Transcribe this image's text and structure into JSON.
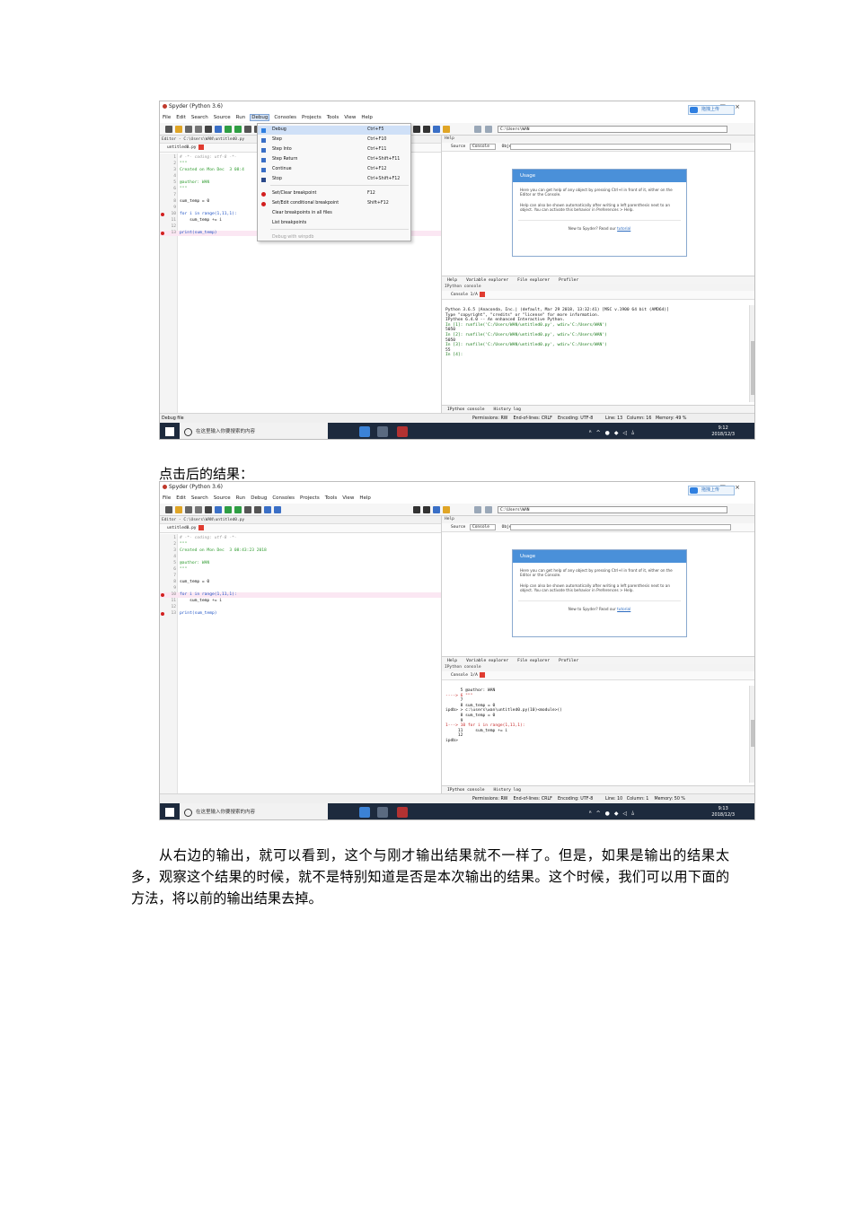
{
  "screenshot1": {
    "window_title": "Spyder (Python 3.6)",
    "menus": [
      "File",
      "Edit",
      "Search",
      "Source",
      "Run",
      "Debug",
      "Consoles",
      "Projects",
      "Tools",
      "View",
      "Help"
    ],
    "cloud_button": "拖拽上传",
    "path": "C:\\Users\\WAN",
    "editor_title": "Editor - C:\\Users\\WAN\\untitled0.py",
    "editor_tab": "untitled0.py",
    "code": [
      {
        "n": "1",
        "t": "# -*- coding: utf-8 -*-"
      },
      {
        "n": "2",
        "t": "\"\"\""
      },
      {
        "n": "3",
        "t": "Created on Mon Dec  3 08:4"
      },
      {
        "n": "4",
        "t": ""
      },
      {
        "n": "5",
        "t": "@author: WAN"
      },
      {
        "n": "6",
        "t": "\"\"\""
      },
      {
        "n": "7",
        "t": ""
      },
      {
        "n": "8",
        "t": "sum_temp = 0"
      },
      {
        "n": "9",
        "t": ""
      },
      {
        "n": "10",
        "t": "for i in range(1,11,1):"
      },
      {
        "n": "11",
        "t": "    sum_temp += i"
      },
      {
        "n": "12",
        "t": ""
      },
      {
        "n": "13",
        "t": "print(sum_temp)"
      }
    ],
    "debug_menu": [
      {
        "label": "Debug",
        "shortcut": "Ctrl+F5"
      },
      {
        "label": "Step",
        "shortcut": "Ctrl+F10"
      },
      {
        "label": "Step Into",
        "shortcut": "Ctrl+F11"
      },
      {
        "label": "Step Return",
        "shortcut": "Ctrl+Shift+F11"
      },
      {
        "label": "Continue",
        "shortcut": "Ctrl+F12"
      },
      {
        "label": "Stop",
        "shortcut": "Ctrl+Shift+F12"
      },
      {
        "label": "Set/Clear breakpoint",
        "shortcut": "F12"
      },
      {
        "label": "Set/Edit conditional breakpoint",
        "shortcut": "Shift+F12"
      },
      {
        "label": "Clear breakpoints in all files",
        "shortcut": ""
      },
      {
        "label": "List breakpoints",
        "shortcut": ""
      },
      {
        "label": "Debug with winpdb",
        "shortcut": ""
      }
    ],
    "help_title": "Help",
    "source_label": "Source",
    "source_value": "Console",
    "object_label": "Object",
    "usage_title": "Usage",
    "usage_p1": "Here you can get help of any object by pressing Ctrl+I in front of it, either on the Editor or the Console.",
    "usage_p2": "Help can also be shown automatically after writing a left parenthesis next to an object. You can activate this behavior in Preferences > Help.",
    "usage_new": "New to Spyder? Read our",
    "usage_link": "tutorial",
    "pane_tabs": [
      "Help",
      "Variable explorer",
      "File explorer",
      "Profiler"
    ],
    "console_title": "IPython console",
    "console_tab": "Console 1/A",
    "console_lines": [
      "Python 3.6.5 |Anaconda, Inc.| (default, Mar 29 2018, 13:32:41) [MSC v.1900 64 bit (AMD64)]",
      "Type \"copyright\", \"credits\" or \"license\" for more information.",
      "",
      "IPython 6.4.0 -- An enhanced Interactive Python.",
      "",
      "In [1]: runfile('C:/Users/WAN/untitled0.py', wdir='C:/Users/WAN')",
      "5050",
      "",
      "In [2]: runfile('C:/Users/WAN/untitled0.py', wdir='C:/Users/WAN')",
      "5050",
      "",
      "In [3]: runfile('C:/Users/WAN/untitled0.py', wdir='C:/Users/WAN')",
      "55",
      "",
      "In [4]:"
    ],
    "console_tabs": [
      "IPython console",
      "History log"
    ],
    "status_left": "Debug file",
    "status_right": "Permissions: RW    End-of-lines: CRLF    Encoding: UTF-8         Line: 13   Column: 16   Memory: 49 %",
    "search_placeholder": "在这里输入你要搜索的内容",
    "clock_time": "9:12",
    "clock_date": "2018/12/3"
  },
  "caption": "点击后的结果：",
  "screenshot2": {
    "window_title": "Spyder (Python 3.6)",
    "menus": [
      "File",
      "Edit",
      "Search",
      "Source",
      "Run",
      "Debug",
      "Consoles",
      "Projects",
      "Tools",
      "View",
      "Help"
    ],
    "cloud_button": "拖拽上传",
    "path": "C:\\Users\\WAN",
    "editor_title": "Editor - C:\\Users\\WAN\\untitled0.py",
    "editor_tab": "untitled0.py",
    "code": [
      {
        "n": "1",
        "t": "# -*- coding: utf-8 -*-"
      },
      {
        "n": "2",
        "t": "\"\"\""
      },
      {
        "n": "3",
        "t": "Created on Mon Dec  3 08:43:23 2018"
      },
      {
        "n": "4",
        "t": ""
      },
      {
        "n": "5",
        "t": "@author: WAN"
      },
      {
        "n": "6",
        "t": "\"\"\""
      },
      {
        "n": "7",
        "t": ""
      },
      {
        "n": "8",
        "t": "sum_temp = 0"
      },
      {
        "n": "9",
        "t": ""
      },
      {
        "n": "10",
        "t": "for i in range(1,11,1):"
      },
      {
        "n": "11",
        "t": "    sum_temp += i"
      },
      {
        "n": "12",
        "t": ""
      },
      {
        "n": "13",
        "t": "print(sum_temp)"
      }
    ],
    "help_title": "Help",
    "source_label": "Source",
    "source_value": "Console",
    "object_label": "Object",
    "usage_title": "Usage",
    "usage_p1": "Here you can get help of any object by pressing Ctrl+I in front of it, either on the Editor or the Console.",
    "usage_p2": "Help can also be shown automatically after writing a left parenthesis next to an object. You can activate this behavior in Preferences > Help.",
    "usage_new": "New to Spyder? Read our",
    "usage_link": "tutorial",
    "pane_tabs": [
      "Help",
      "Variable explorer",
      "File explorer",
      "Profiler"
    ],
    "console_title": "IPython console",
    "console_tab": "Console 1/A",
    "console_lines": [
      "      5 @author: WAN",
      "----> 6 \"\"\"",
      "      7",
      "      8 sum_temp = 0",
      "",
      "ipdb> > c:\\users\\wan\\untitled0.py(10)<module>()",
      "      8 sum_temp = 0",
      "      9",
      "1---> 10 for i in range(1,11,1):",
      "     11     sum_temp += i",
      "     12",
      "",
      "ipdb>"
    ],
    "console_tabs": [
      "IPython console",
      "History log"
    ],
    "status_left": "",
    "status_right": "Permissions: RW    End-of-lines: CRLF    Encoding: UTF-8         Line: 10   Column: 1    Memory: 50 %",
    "search_placeholder": "在这里输入你要搜索的内容",
    "clock_time": "9:13",
    "clock_date": "2018/12/3"
  },
  "paragraph": "从右边的输出，就可以看到，这个与刚才输出结果就不一样了。但是，如果是输出的结果太多，观察这个结果的时候，就不是特别知道是否是本次输出的结果。这个时候，我们可以用下面的方法，将以前的输出结果去掉。"
}
